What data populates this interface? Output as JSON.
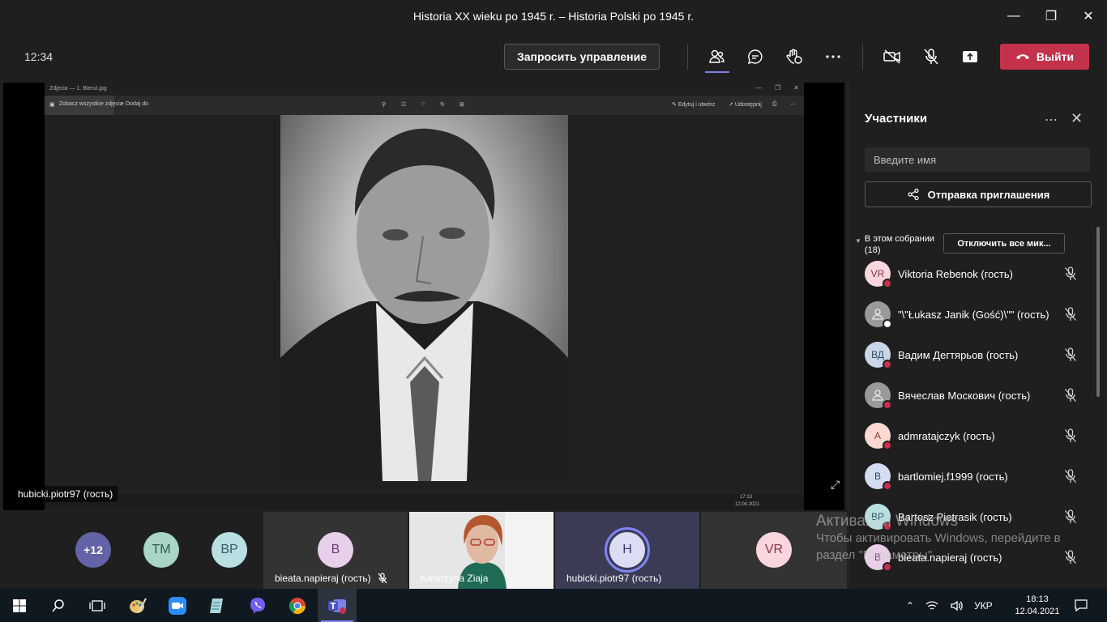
{
  "window": {
    "title": "Historia XX wieku po 1945 r. – Historia Polski po 1945 r.",
    "controls": [
      "minimize-icon",
      "maximize-icon",
      "close-icon"
    ]
  },
  "toolbar": {
    "time": "12:34",
    "request_control_label": "Запросить управление",
    "leave_label": "Выйти",
    "icons": [
      "participants-icon",
      "chat-icon",
      "raise-hand-icon",
      "more-icon",
      "camera-off-icon",
      "mic-off-icon",
      "share-icon"
    ]
  },
  "stage": {
    "presenter_name": "hubicki.piotr97 (гость)",
    "shared_app": {
      "title": "Zdjęcia — 1. Bierut.jpg",
      "see_all_label": "Zobacz wszystkie zdjęcia",
      "add_label": "Dodaj do",
      "edit_label": "Edytuj i utwórz",
      "share_label": "Udostępnij",
      "taskbar_time": "17:13",
      "taskbar_date": "12.04.2021"
    }
  },
  "strip": {
    "more_count": "+12",
    "avatars": [
      {
        "initials": "TM",
        "bg": "#a8d5c4",
        "fg": "#2b5a4a"
      },
      {
        "initials": "BP",
        "bg": "#b9dfe3",
        "fg": "#335a60"
      }
    ],
    "tiles": [
      {
        "initials": "B",
        "name": "bieata.napieraj (гость)",
        "bg": "#e8d0ea",
        "fg": "#6b3b70",
        "muted": true
      },
      {
        "initials": "",
        "name": "Katarzyna Ziaja",
        "video": true
      },
      {
        "initials": "H",
        "name": "hubicki.piotr97 (гость)",
        "bg": "#dcdcf4",
        "fg": "#3b3b70",
        "speaking": true
      },
      {
        "initials": "VR",
        "name": "",
        "bg": "#f9d6de",
        "fg": "#8a3446"
      }
    ]
  },
  "watermark": {
    "title": "Активация Windows",
    "line": "Чтобы активировать Windows, перейдите в раздел \"Параметры\"."
  },
  "panel": {
    "title": "Участники",
    "search_placeholder": "Введите имя",
    "invite_label": "Отправка приглашения",
    "section_label": "В этом собрании",
    "section_count": "(18)",
    "mute_all_label": "Отключить все мик...",
    "participants": [
      {
        "initials": "VR",
        "name": "Viktoria Rebenok (гость)",
        "bg": "#f9d6de",
        "fg": "#8a3446",
        "status": "#c4314b"
      },
      {
        "initials": "",
        "name": "\"\\\"Łukasz Janik (Gość)\\\"\" (гость)",
        "bg": "#9a9a9a",
        "fg": "#eaeaea",
        "status": "#ffffff",
        "generic": true
      },
      {
        "initials": "ВД",
        "name": "Вадим Дегтярьов (гость)",
        "bg": "#c9d6e8",
        "fg": "#34486b",
        "status": "#c4314b"
      },
      {
        "initials": "",
        "name": "Вячеслав Москович (гость)",
        "bg": "#9a9a9a",
        "fg": "#eaeaea",
        "status": "#c4314b",
        "generic": true
      },
      {
        "initials": "A",
        "name": "admratajczyk (гость)",
        "bg": "#fbd9d2",
        "fg": "#8a3b2b",
        "status": "#c4314b"
      },
      {
        "initials": "B",
        "name": "bartlomiej.f1999 (гость)",
        "bg": "#d4def0",
        "fg": "#34486b",
        "status": "#c4314b"
      },
      {
        "initials": "BP",
        "name": "Bartosz Pietrasik (гость)",
        "bg": "#b9dfe3",
        "fg": "#335a60",
        "status": "#c4314b"
      },
      {
        "initials": "B",
        "name": "bieata.napieraj (гость)",
        "bg": "#e8d0ea",
        "fg": "#6b3b70",
        "status": "#c4314b"
      }
    ]
  },
  "taskbar": {
    "apps": [
      "windows-start-icon",
      "search-icon",
      "task-view-icon",
      "paint-icon",
      "zoom-icon",
      "notepad-icon",
      "viber-icon",
      "chrome-icon",
      "teams-icon"
    ],
    "language": "УКР",
    "time": "18:13",
    "date": "12.04.2021"
  },
  "colors": {
    "accent_red": "#c4314b",
    "bg": "#1f1f1f",
    "teams_purple": "#6264a7"
  }
}
